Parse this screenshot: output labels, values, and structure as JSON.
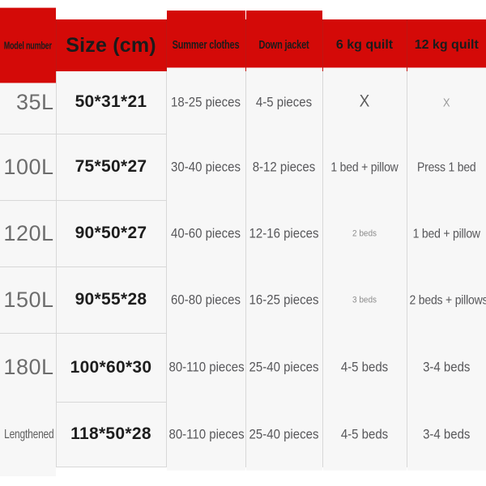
{
  "table": {
    "headers": [
      {
        "label": "Model number",
        "style": "h-model"
      },
      {
        "label": "Size (cm)",
        "style": "h-size"
      },
      {
        "label": "Summer clothes",
        "style": "h-small"
      },
      {
        "label": "Down jacket",
        "style": "h-small"
      },
      {
        "label": "6 kg quilt",
        "style": "h-med"
      },
      {
        "label": "12 kg quilt",
        "style": "h-med"
      }
    ],
    "header_bg": "#d40a08",
    "header_text_color": "#1b1b1b",
    "body_bg": "#f7f7f7",
    "grid_color": "#d8d8d8",
    "rows": [
      {
        "model": "35L",
        "size": "50*31*21",
        "summer_clothes": "18-25 pieces",
        "down_jacket": "4-5 pieces",
        "quilt_6kg": "X",
        "quilt_12kg": "X",
        "quilt_6kg_style": "mark",
        "quilt_12kg_style": "mark faint"
      },
      {
        "model": "100L",
        "size": "75*50*27",
        "summer_clothes": "30-40 pieces",
        "down_jacket": "8-12 pieces",
        "quilt_6kg": "1 bed + pillow",
        "quilt_12kg": "Press 1 bed",
        "quilt_6kg_style": "narrow",
        "quilt_12kg_style": "narrow"
      },
      {
        "model": "120L",
        "size": "90*50*27",
        "summer_clothes": "40-60 pieces",
        "down_jacket": "12-16 pieces",
        "quilt_6kg": "2 beds",
        "quilt_12kg": "1 bed + pillow",
        "quilt_6kg_style": "small",
        "quilt_12kg_style": "narrow"
      },
      {
        "model": "150L",
        "size": "90*55*28",
        "summer_clothes": "60-80 pieces",
        "down_jacket": "16-25 pieces",
        "quilt_6kg": "3 beds",
        "quilt_12kg": "2 beds + pillows",
        "quilt_6kg_style": "small",
        "quilt_12kg_style": "narrow"
      },
      {
        "model": "180L",
        "size": "100*60*30",
        "summer_clothes": "80-110 pieces",
        "down_jacket": "25-40 pieces",
        "quilt_6kg": "4-5 beds",
        "quilt_12kg": "3-4 beds",
        "quilt_6kg_style": "",
        "quilt_12kg_style": ""
      },
      {
        "model": "Lengthened",
        "size": "118*50*28",
        "summer_clothes": "80-110 pieces",
        "down_jacket": "25-40 pieces",
        "quilt_6kg": "4-5 beds",
        "quilt_12kg": "3-4 beds",
        "quilt_6kg_style": "",
        "quilt_12kg_style": "",
        "model_style": "tiny"
      }
    ]
  }
}
